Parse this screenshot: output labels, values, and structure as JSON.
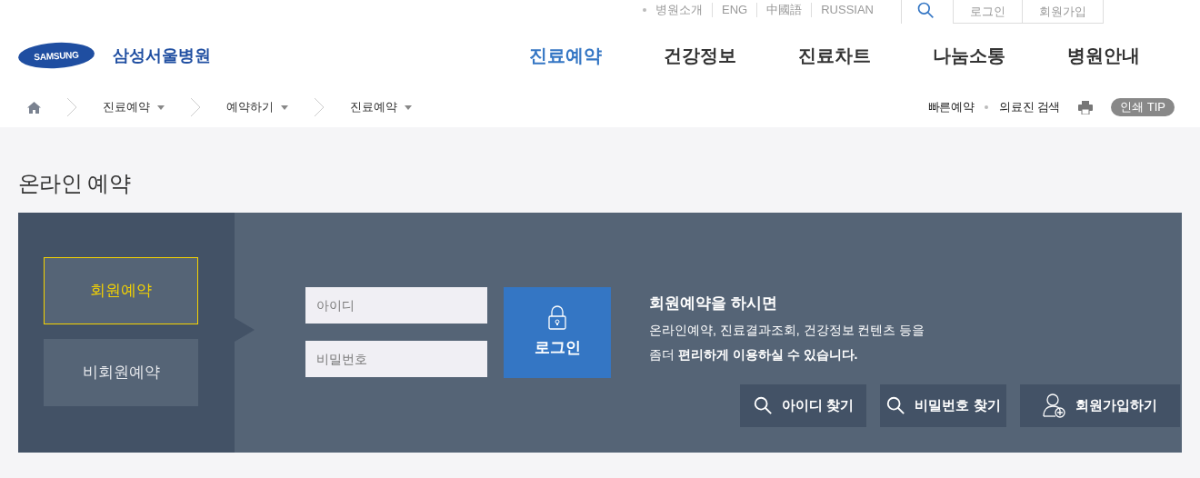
{
  "utility_links": [
    "병원소개",
    "ENG",
    "中國語",
    "RUSSIAN"
  ],
  "account_links": [
    "로그인",
    "회원가입"
  ],
  "logo": {
    "brand": "SAMSUNG",
    "name": "삼성서울병원"
  },
  "nav": [
    {
      "label": "진료예약",
      "selected": true
    },
    {
      "label": "건강정보",
      "selected": false
    },
    {
      "label": "진료차트",
      "selected": false
    },
    {
      "label": "나눔소통",
      "selected": false
    },
    {
      "label": "병원안내",
      "selected": false
    }
  ],
  "breadcrumb": [
    "진료예약",
    "예약하기",
    "진료예약"
  ],
  "quick_links": [
    "빠른예약",
    "의료진 검색"
  ],
  "print_tip": "인쇄 TIP",
  "page_title": "온라인 예약",
  "tabs": [
    {
      "label": "회원예약",
      "selected": true
    },
    {
      "label": "비회원예약",
      "selected": false
    }
  ],
  "login_form": {
    "id_placeholder": "아이디",
    "password_placeholder": "비밀번호",
    "submit": "로그인"
  },
  "info": {
    "heading": "회원예약을 하시면",
    "line_1": "온라인예약, 진료결과조회, 건강정보 컨텐츠 등을",
    "line_2": "좀더 **편리하게 이용하실 수 있습니다.**"
  },
  "actions": [
    {
      "kind": "search",
      "label": "아이디 찾기"
    },
    {
      "kind": "search",
      "label": "비밀번호 찾기"
    },
    {
      "kind": "user",
      "label": "회원가입하기"
    }
  ]
}
